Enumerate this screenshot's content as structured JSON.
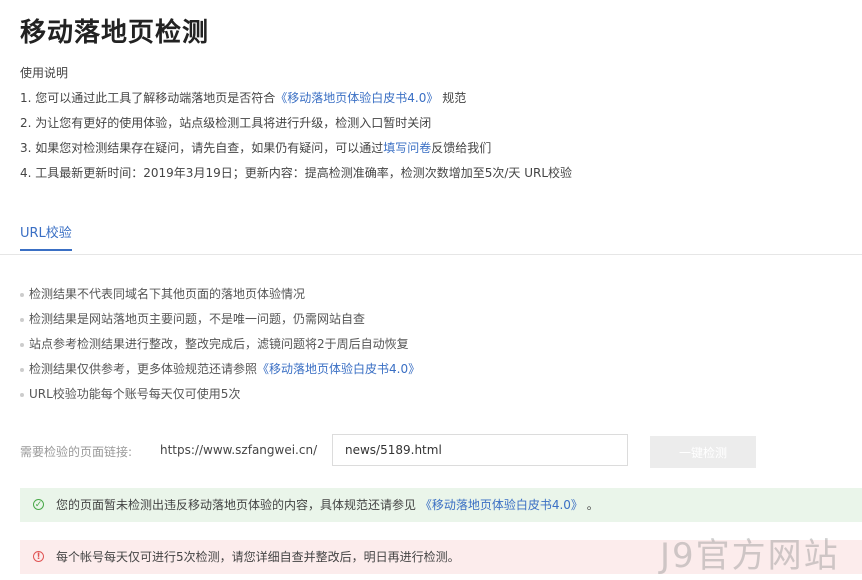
{
  "page_title": "移动落地页检测",
  "instructions": {
    "heading": "使用说明",
    "line1": {
      "pre": "1. 您可以通过此工具了解移动端落地页是否符合",
      "link": "《移动落地页体验白皮书4.0》",
      "post": "规范"
    },
    "line2": "2. 为让您有更好的使用体验，站点级检测工具将进行升级，检测入口暂时关闭",
    "line3": {
      "pre": "3. 如果您对检测结果存在疑问，请先自查，如果仍有疑问，可以通过",
      "link": "填写问卷",
      "post": "反馈给我们"
    },
    "line4": "4. 工具最新更新时间：2019年3月19日；更新内容：提高检测准确率，检测次数增加至5次/天 URL校验"
  },
  "tabs": {
    "active": "URL校验"
  },
  "notes": {
    "n1": "检测结果不代表同域名下其他页面的落地页体验情况",
    "n2": "检测结果是网站落地页主要问题，不是唯一问题，仍需网站自查",
    "n3": "站点参考检测结果进行整改，整改完成后，滤镜问题将2于周后自动恢复",
    "n4": {
      "pre": "检测结果仅供参考，更多体验规范还请参照",
      "link": "《移动落地页体验白皮书4.0》"
    },
    "n5": "URL校验功能每个账号每天仅可使用5次"
  },
  "form": {
    "label": "需要检验的页面链接:",
    "prefix": "https://www.szfangwei.cn/",
    "input_value": "news/5189.html",
    "button_label": "一键检测"
  },
  "result": {
    "success": {
      "pre": "您的页面暂未检测出违反移动落地页体验的内容，具体规范还请参见",
      "link": "《移动落地页体验白皮书4.0》",
      "post": "。"
    },
    "error": "每个帐号每天仅可进行5次检测，请您详细自查并整改后，明日再进行检测。"
  },
  "watermark": "J9官方网站",
  "colors": {
    "accent": "#3a6fc4",
    "success": "#49a849",
    "error": "#e05555"
  }
}
